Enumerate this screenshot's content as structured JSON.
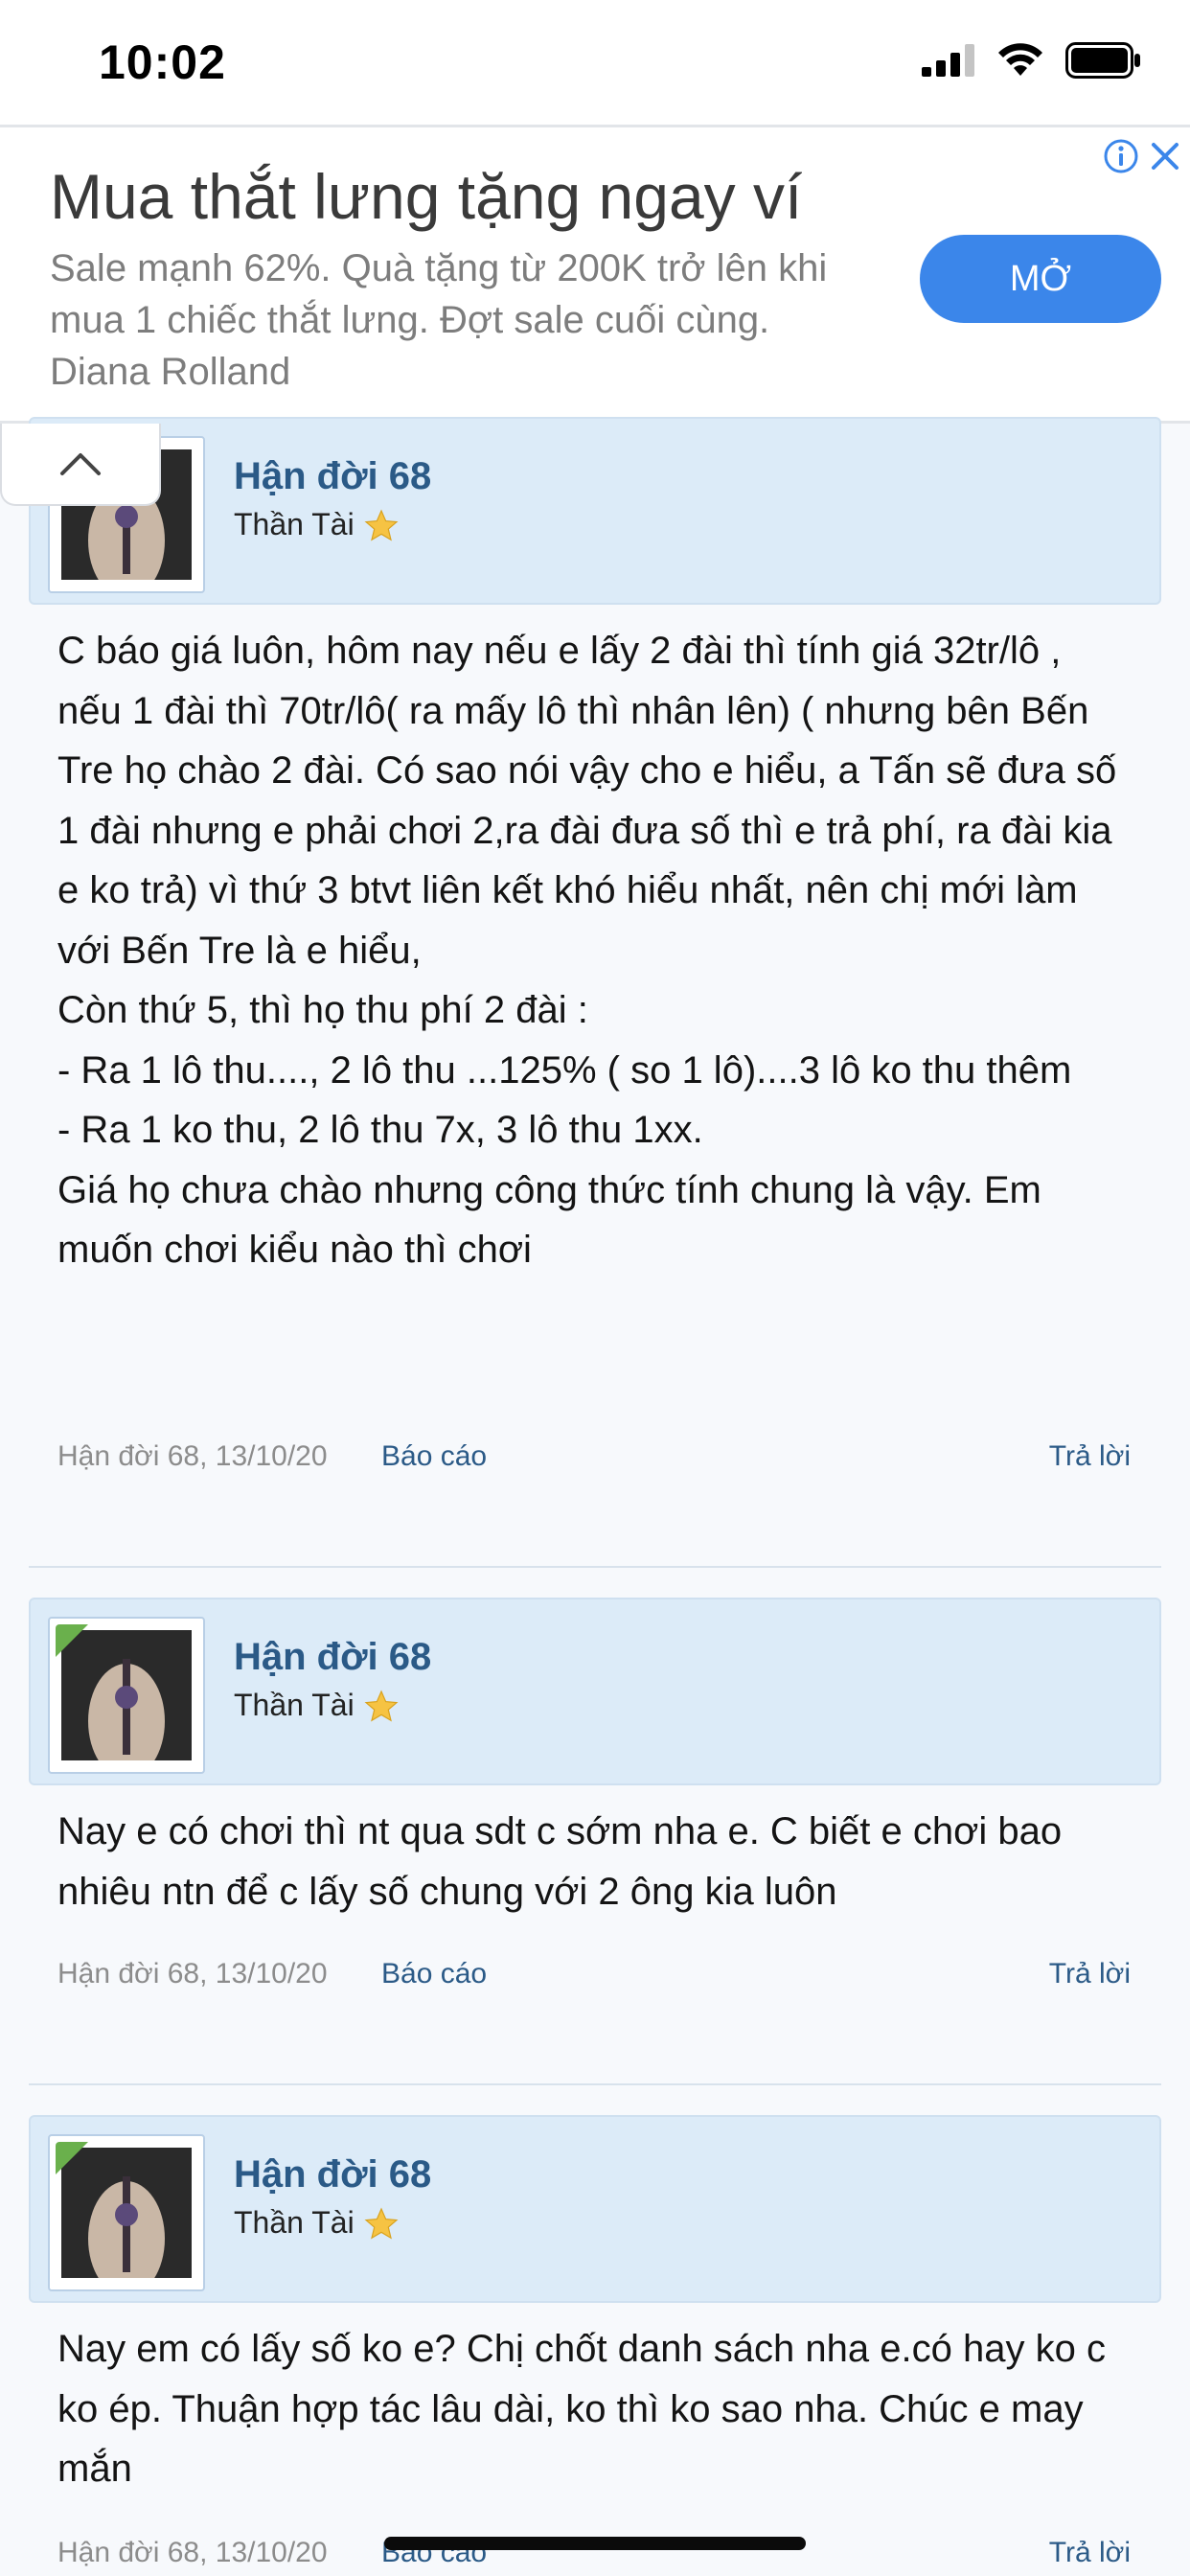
{
  "status_bar": {
    "time": "10:02"
  },
  "ad": {
    "title": "Mua thắt lưng tặng ngay ví",
    "description": "Sale mạnh 62%. Quà tặng từ 200K trở lên khi mua 1 chiếc thắt lưng. Đợt sale cuối cùng.",
    "advertiser": "Diana Rolland",
    "open_label": "MỞ"
  },
  "posts": [
    {
      "author": "Hận đời 68",
      "user_title": "Thần Tài",
      "body": "C báo giá luôn, hôm nay nếu e lấy 2 đài thì tính giá 32tr/lô , nếu 1 đài thì 70tr/lô( ra mấy lô thì nhân lên) ( nhưng bên Bến Tre họ chào 2 đài. Có sao nói vậy cho e hiểu, a Tấn sẽ đưa số 1 đài nhưng e phải chơi 2,ra đài đưa số thì e trả phí, ra đài kia e ko trả) vì thứ 3 btvt liên kết khó hiểu nhất, nên chị mới làm với Bến Tre là e hiểu,\nCòn thứ 5, thì họ thu phí 2 đài :\n- Ra 1 lô thu...., 2 lô thu ...125% ( so 1 lô)....3 lô ko thu thêm\n- Ra 1 ko thu, 2 lô thu 7x, 3 lô thu 1xx.\nGiá họ chưa chào nhưng công thức tính chung là vậy. Em muốn chơi kiểu nào thì chơi",
      "meta": "Hận đời 68, 13/10/20",
      "report_label": "Báo cáo",
      "reply_label": "Trả lời"
    },
    {
      "author": "Hận đời 68",
      "user_title": "Thần Tài",
      "body": "Nay e có chơi thì nt qua sdt c sớm nha e. C biết e chơi bao nhiêu ntn để c lấy số chung với 2 ông kia luôn",
      "meta": "Hận đời 68, 13/10/20",
      "report_label": "Báo cáo",
      "reply_label": "Trả lời"
    },
    {
      "author": "Hận đời 68",
      "user_title": "Thần Tài",
      "body": "Nay em có lấy số ko e? Chị chốt danh sách nha e.có hay ko c ko ép. Thuận hợp tác lâu dài, ko thì ko sao nha. Chúc e may mắn",
      "meta": "Hận đời 68, 13/10/20",
      "report_label": "Báo cáo",
      "reply_label": "Trả lời"
    }
  ],
  "colors": {
    "accent": "#3b86ea",
    "link": "#2b5a87",
    "post_header_bg": "#dcebf8",
    "page_bg": "#f7f9fc"
  }
}
